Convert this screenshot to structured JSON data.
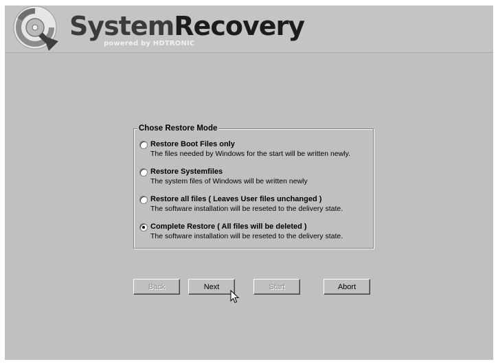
{
  "banner": {
    "logo_icon": "disk-recovery-icon",
    "title_part1": "System",
    "title_part2": "Recovery",
    "subtitle": "powered by HDTRONIC"
  },
  "restore_mode": {
    "legend": "Chose Restore Mode",
    "options": [
      {
        "label": "Restore Boot Files only",
        "description": "The files needed by Windows for the start will be written newly.",
        "selected": false
      },
      {
        "label": "Restore Systemfiles",
        "description": "The system files of Windows will be written newly",
        "selected": false
      },
      {
        "label": "Restore all files ( Leaves User files unchanged )",
        "description": "The software installation will be reseted to the delivery state.",
        "selected": false
      },
      {
        "label": "Complete Restore ( All files will be deleted )",
        "description": "The software installation will be reseted to the delivery state.",
        "selected": true
      }
    ]
  },
  "buttons": {
    "back": {
      "label": "Back",
      "enabled": false
    },
    "next": {
      "label": "Next",
      "enabled": true
    },
    "start": {
      "label": "Start",
      "enabled": false
    },
    "abort": {
      "label": "Abort",
      "enabled": true
    }
  },
  "cursor_icon": "arrow-pointer-icon"
}
